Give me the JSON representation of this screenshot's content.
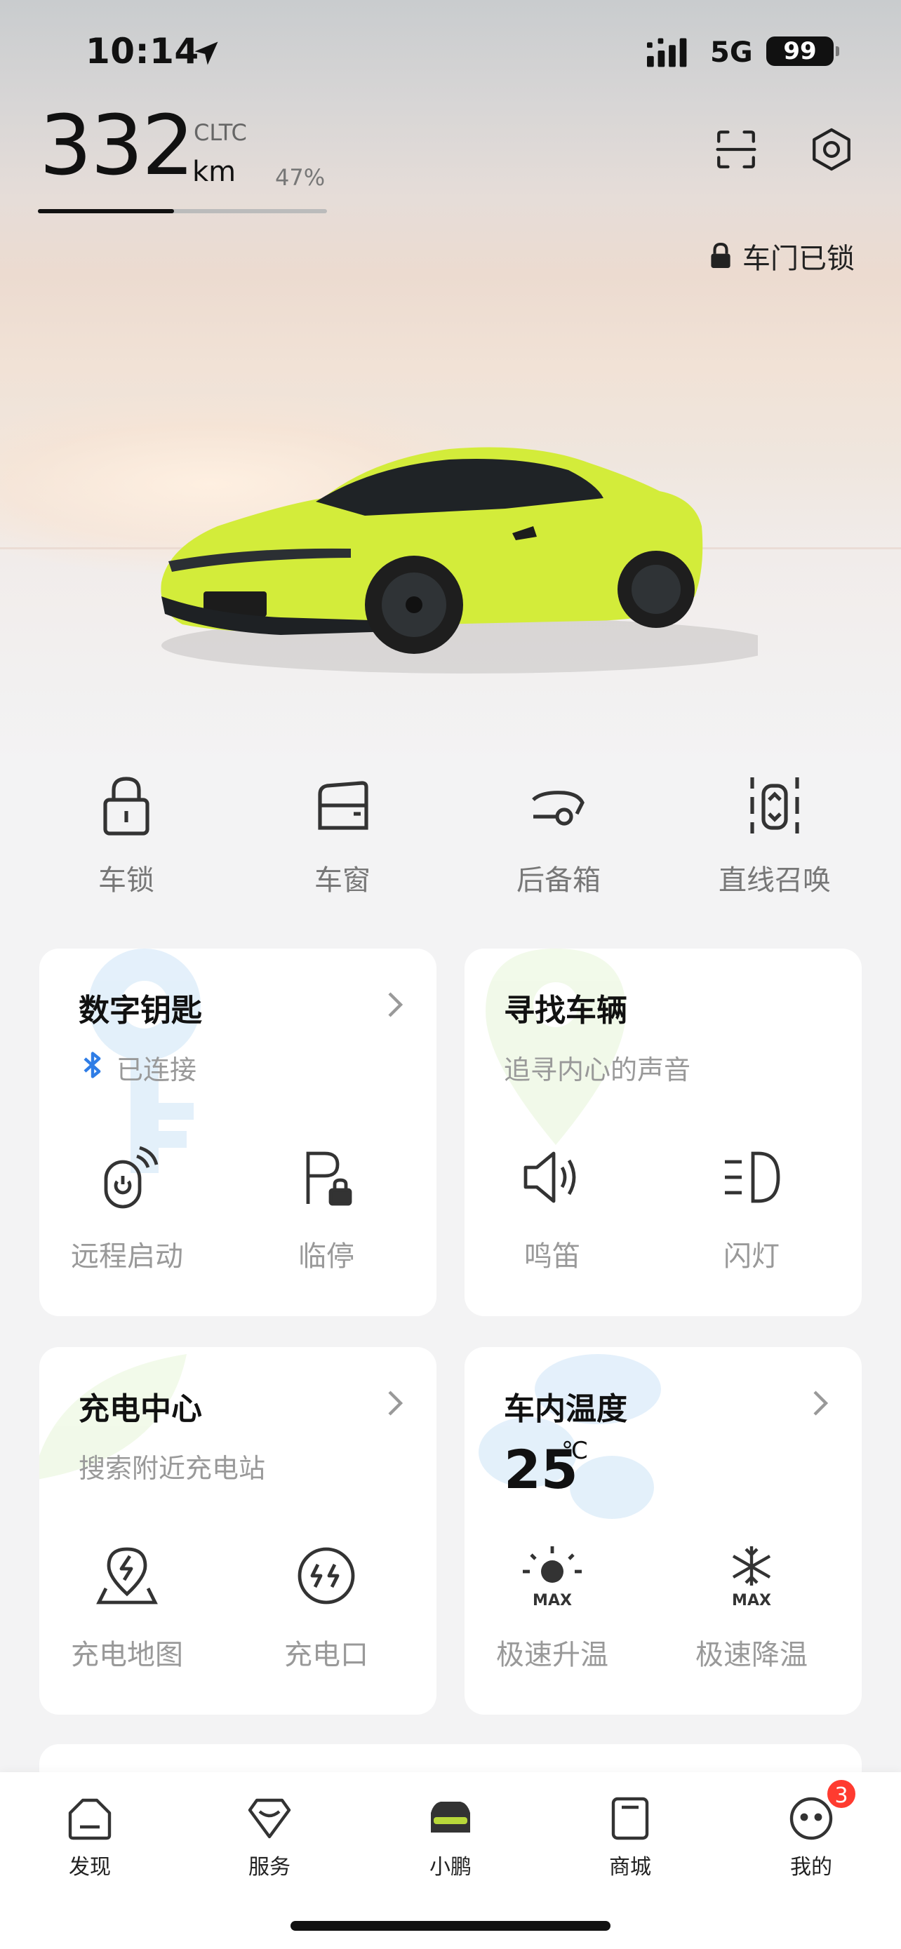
{
  "status_bar": {
    "time": "10:14",
    "network": "5G",
    "battery": "99"
  },
  "range": {
    "value": "332",
    "standard": "CLTC",
    "unit": "km",
    "percent_label": "47%",
    "percent": 0.47
  },
  "lock_status": {
    "label": "车门已锁"
  },
  "quick_actions": [
    {
      "label": "车锁",
      "icon": "lock-icon"
    },
    {
      "label": "车窗",
      "icon": "window-icon"
    },
    {
      "label": "后备箱",
      "icon": "trunk-icon"
    },
    {
      "label": "直线召唤",
      "icon": "summon-icon"
    }
  ],
  "cards": {
    "digital_key": {
      "title": "数字钥匙",
      "status": "已连接",
      "actions": [
        "远程启动",
        "临停"
      ]
    },
    "find_car": {
      "title": "寻找车辆",
      "subtitle": "追寻内心的声音",
      "actions": [
        "鸣笛",
        "闪灯"
      ]
    },
    "charging": {
      "title": "充电中心",
      "subtitle": "搜索附近充电站",
      "actions": [
        "充电地图",
        "充电口"
      ]
    },
    "cabin_temp": {
      "title": "车内温度",
      "value": "25",
      "unit": "℃",
      "actions": [
        "极速升温",
        "极速降温"
      ],
      "max_label": "MAX"
    }
  },
  "tabbar": {
    "tabs": [
      {
        "label": "发现",
        "icon": "discover-icon"
      },
      {
        "label": "服务",
        "icon": "service-icon"
      },
      {
        "label": "小鹏",
        "icon": "car-tab-icon"
      },
      {
        "label": "商城",
        "icon": "store-icon"
      },
      {
        "label": "我的",
        "icon": "profile-icon"
      }
    ],
    "badge": "3"
  },
  "colors": {
    "car_body": "#d3ec3a",
    "accent_blue": "#2f7de6",
    "badge": "#ff3b30",
    "card_bg": "#ffffff"
  }
}
